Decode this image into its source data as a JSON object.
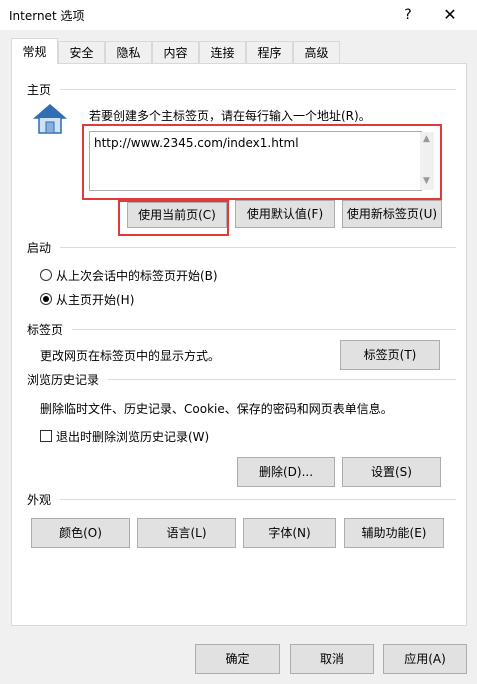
{
  "window": {
    "title": "Internet 选项",
    "help_icon": "?",
    "close_icon": "✕"
  },
  "tabs": [
    {
      "label": "常规",
      "active": true
    },
    {
      "label": "安全"
    },
    {
      "label": "隐私"
    },
    {
      "label": "内容"
    },
    {
      "label": "连接"
    },
    {
      "label": "程序"
    },
    {
      "label": "高级"
    }
  ],
  "home": {
    "title": "主页",
    "instruction": "若要创建多个主标签页，请在每行输入一个地址(R)。",
    "url_value": "http://www.2345.com/index1.html",
    "buttons": {
      "use_current": "使用当前页(C)",
      "use_default": "使用默认值(F)",
      "use_new_tab": "使用新标签页(U)"
    }
  },
  "startup": {
    "title": "启动",
    "option_last_session": "从上次会话中的标签页开始(B)",
    "option_home": "从主页开始(H)",
    "selected": "home"
  },
  "tabs_section": {
    "title": "标签页",
    "description": "更改网页在标签页中的显示方式。",
    "button": "标签页(T)"
  },
  "history": {
    "title": "浏览历史记录",
    "description": "删除临时文件、历史记录、Cookie、保存的密码和网页表单信息。",
    "checkbox_label": "退出时删除浏览历史记录(W)",
    "checked": false,
    "delete_button": "删除(D)...",
    "settings_button": "设置(S)"
  },
  "appearance": {
    "title": "外观",
    "colors": "颜色(O)",
    "languages": "语言(L)",
    "fonts": "字体(N)",
    "accessibility": "辅助功能(E)"
  },
  "footer": {
    "ok": "确定",
    "cancel": "取消",
    "apply": "应用(A)"
  },
  "colors": {
    "highlight_red": "#e03a3a",
    "house_blue": "#2f6db5"
  }
}
